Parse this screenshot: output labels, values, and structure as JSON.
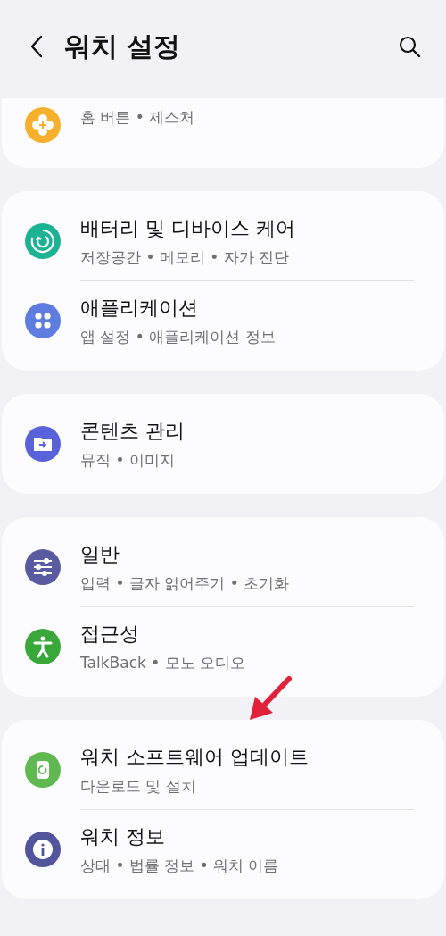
{
  "header": {
    "title": "워치 설정"
  },
  "groups": [
    {
      "clipped": true,
      "items": [
        {
          "kind": "gear",
          "color": "#f6b02c",
          "subtitle": "홈 버튼 • 제스처"
        }
      ]
    },
    {
      "clipped": false,
      "items": [
        {
          "kind": "care",
          "color": "#1cb394",
          "title": "배터리 및 디바이스 케어",
          "subtitle": "저장공간 • 메모리 • 자가 진단"
        },
        {
          "kind": "apps",
          "color": "#5e7de0",
          "title": "애플리케이션",
          "subtitle": "앱 설정 • 애플리케이션 정보"
        }
      ]
    },
    {
      "clipped": false,
      "items": [
        {
          "kind": "folder",
          "color": "#5a62d9",
          "title": "콘텐츠 관리",
          "subtitle": "뮤직 • 이미지"
        }
      ]
    },
    {
      "clipped": false,
      "items": [
        {
          "kind": "sliders",
          "color": "#595a9f",
          "title": "일반",
          "subtitle": "입력 • 글자 읽어주기 • 초기화"
        },
        {
          "kind": "person",
          "color": "#3aa73a",
          "title": "접근성",
          "subtitle": "TalkBack • 모노 오디오"
        }
      ]
    },
    {
      "clipped": false,
      "items": [
        {
          "kind": "watch",
          "color": "#5fb950",
          "title": "워치 소프트웨어 업데이트",
          "subtitle": "다운로드 및 설치"
        },
        {
          "kind": "info",
          "color": "#52549c",
          "title": "워치 정보",
          "subtitle": "상태 • 법률 정보 • 워치 이름"
        }
      ]
    }
  ]
}
